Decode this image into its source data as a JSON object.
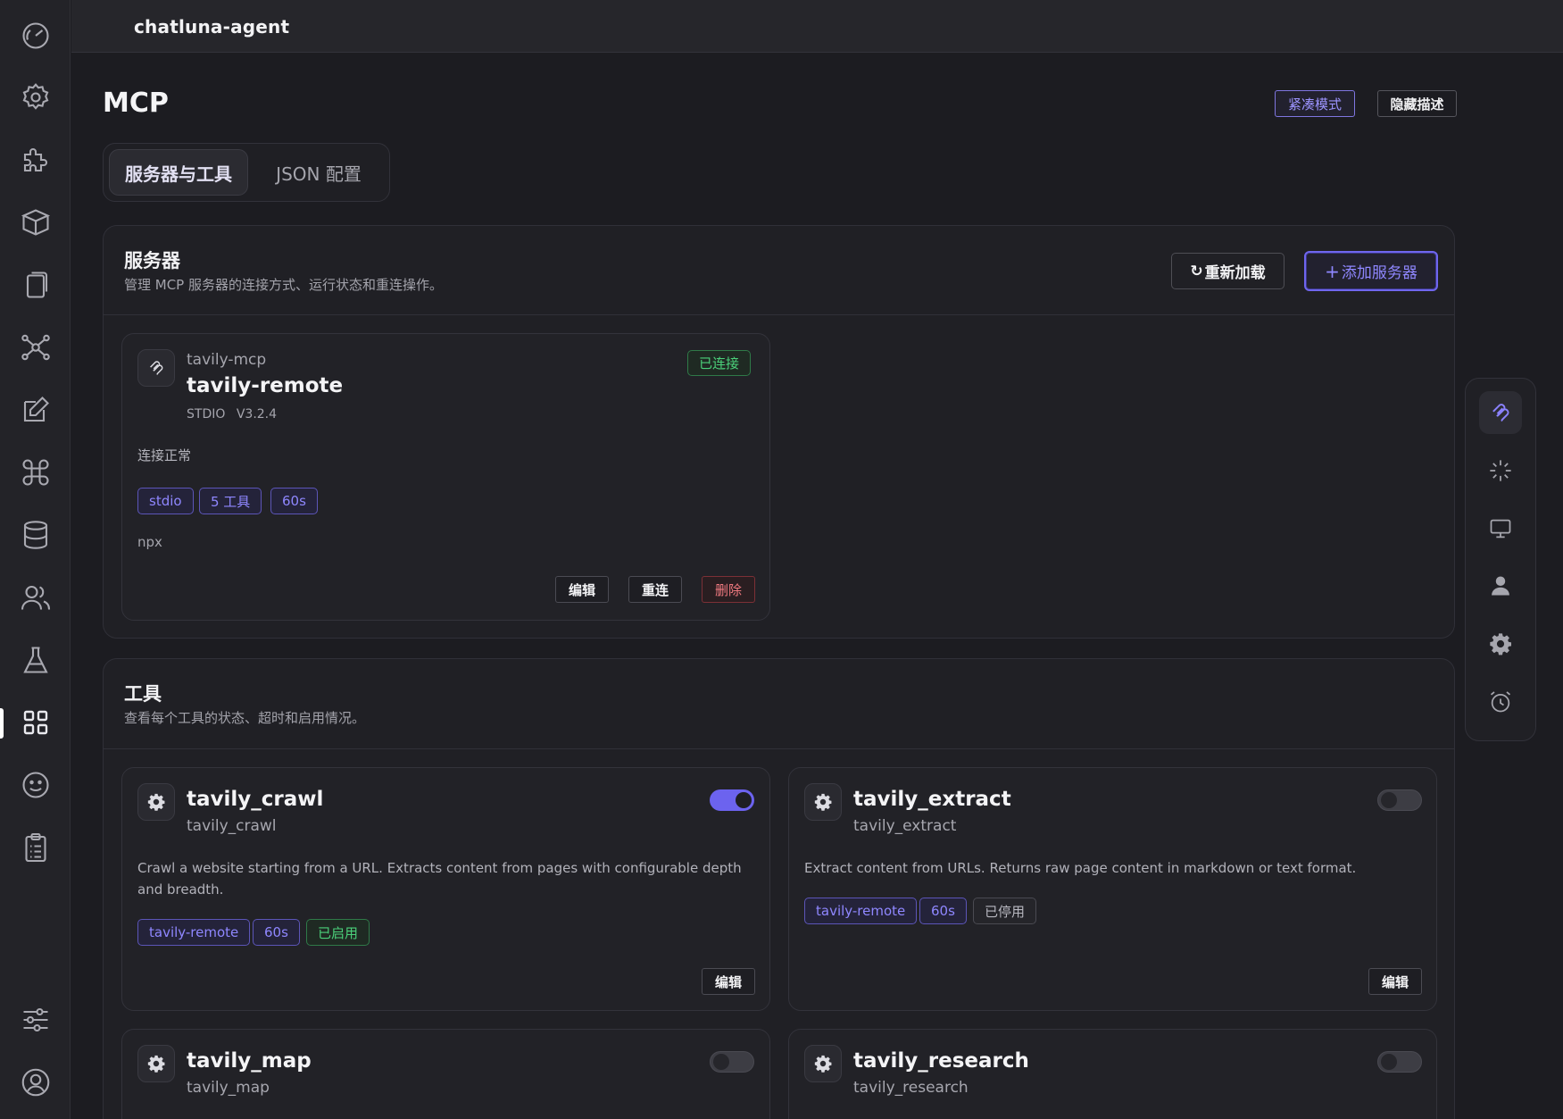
{
  "app": {
    "name": "chatluna-agent"
  },
  "page": {
    "title": "MCP",
    "compact_mode_label": "紧凑模式",
    "hide_desc_label": "隐藏描述"
  },
  "tabs": [
    {
      "label": "服务器与工具",
      "active": true
    },
    {
      "label": "JSON 配置",
      "active": false
    }
  ],
  "sidebar": {
    "items": [
      {
        "icon": "dashboard-gauge-icon"
      },
      {
        "icon": "gear-icon"
      },
      {
        "icon": "puzzle-icon"
      },
      {
        "icon": "package-box-icon"
      },
      {
        "icon": "documents-icon"
      },
      {
        "icon": "network-graph-icon"
      },
      {
        "icon": "edit-icon"
      },
      {
        "icon": "command-icon"
      },
      {
        "icon": "database-icon"
      },
      {
        "icon": "users-icon"
      },
      {
        "icon": "flask-icon"
      },
      {
        "icon": "grid-apps-icon",
        "active": true
      },
      {
        "icon": "smiley-icon"
      },
      {
        "icon": "clipboard-list-icon"
      },
      {
        "icon": "sliders-icon"
      },
      {
        "icon": "user-circle-icon"
      }
    ]
  },
  "servers": {
    "title": "服务器",
    "description": "管理 MCP 服务器的连接方式、运行状态和重连操作。",
    "reload_label": "重新加载",
    "add_label": "添加服务器",
    "items": [
      {
        "package": "tavily-mcp",
        "name": "tavily-remote",
        "transport": "STDIO",
        "version": "V3.2.4",
        "status": "已连接",
        "status_text": "连接正常",
        "tags": [
          "stdio",
          "5 工具",
          "60s"
        ],
        "command": "npx",
        "edit_label": "编辑",
        "reconnect_label": "重连",
        "delete_label": "删除"
      }
    ]
  },
  "tools": {
    "title": "工具",
    "description": "查看每个工具的状态、超时和启用情况。",
    "items": [
      {
        "name": "tavily_crawl",
        "id": "tavily_crawl",
        "enabled": true,
        "description": "Crawl a website starting from a URL. Extracts content from pages with configurable depth and breadth.",
        "tags": [
          "tavily-remote",
          "60s"
        ],
        "status_tag": "已启用",
        "edit_label": "编辑"
      },
      {
        "name": "tavily_extract",
        "id": "tavily_extract",
        "enabled": false,
        "description": "Extract content from URLs. Returns raw page content in markdown or text format.",
        "tags": [
          "tavily-remote",
          "60s"
        ],
        "status_tag": "已停用",
        "edit_label": "编辑"
      },
      {
        "name": "tavily_map",
        "id": "tavily_map",
        "enabled": false
      },
      {
        "name": "tavily_research",
        "id": "tavily_research",
        "enabled": false
      }
    ]
  },
  "right_panel": {
    "items": [
      {
        "icon": "mcp-link-icon",
        "active": true
      },
      {
        "icon": "sparkle-icon"
      },
      {
        "icon": "monitor-icon"
      },
      {
        "icon": "person-icon"
      },
      {
        "icon": "cog-icon"
      },
      {
        "icon": "alarm-clock-icon"
      }
    ]
  },
  "colors": {
    "accent": "#6c63ef",
    "accent_text": "#8f87ff",
    "success": "#4bd07a",
    "danger": "#f07a80",
    "background": "#1c1c21"
  }
}
